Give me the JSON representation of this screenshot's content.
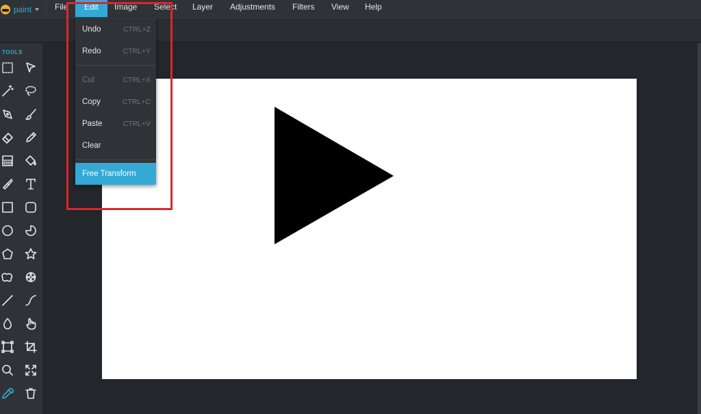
{
  "app": {
    "name": "paint",
    "accent": "#35a9d6",
    "annotation_color": "#e0242b"
  },
  "menubar": {
    "items": [
      {
        "label": "File"
      },
      {
        "label": "Edit",
        "active": true
      },
      {
        "label": "Image"
      },
      {
        "label": "Select"
      },
      {
        "label": "Layer"
      },
      {
        "label": "Adjustments"
      },
      {
        "label": "Filters"
      },
      {
        "label": "View"
      },
      {
        "label": "Help"
      }
    ]
  },
  "edit_menu": {
    "items": [
      {
        "label": "Undo",
        "shortcut": "CTRL+Z",
        "enabled": true
      },
      {
        "label": "Redo",
        "shortcut": "CTRL+Y",
        "enabled": true
      },
      {
        "label": "Cut",
        "shortcut": "CTRL+X",
        "enabled": false
      },
      {
        "label": "Copy",
        "shortcut": "CTRL+C",
        "enabled": true
      },
      {
        "label": "Paste",
        "shortcut": "CTRL+V",
        "enabled": true
      },
      {
        "label": "Clear",
        "shortcut": "",
        "enabled": true
      },
      {
        "label": "Free Transform",
        "shortcut": "",
        "enabled": true,
        "highlighted": true
      }
    ]
  },
  "tools": {
    "title": "TOOLS",
    "items": [
      "rectangle-select-icon",
      "pointer-icon",
      "magic-wand-icon",
      "lasso-icon",
      "pen-icon",
      "brush-icon",
      "eraser-icon",
      "pencil-icon",
      "pattern-fill-icon",
      "paint-bucket-icon",
      "clone-stamp-icon",
      "text-icon",
      "rectangle-icon",
      "rounded-rectangle-icon",
      "ellipse-icon",
      "pie-icon",
      "polygon-icon",
      "star-icon",
      "blob-icon",
      "gear-shape-icon",
      "line-icon",
      "curve-icon",
      "drop-icon",
      "hand-icon",
      "transform-icon",
      "crop-icon",
      "zoom-icon",
      "fit-screen-icon",
      "color-picker-icon",
      "trash-icon"
    ],
    "selected": "color-picker-icon"
  },
  "canvas": {
    "background": "#ffffff",
    "shape": "triangle",
    "shape_color": "#000000"
  }
}
